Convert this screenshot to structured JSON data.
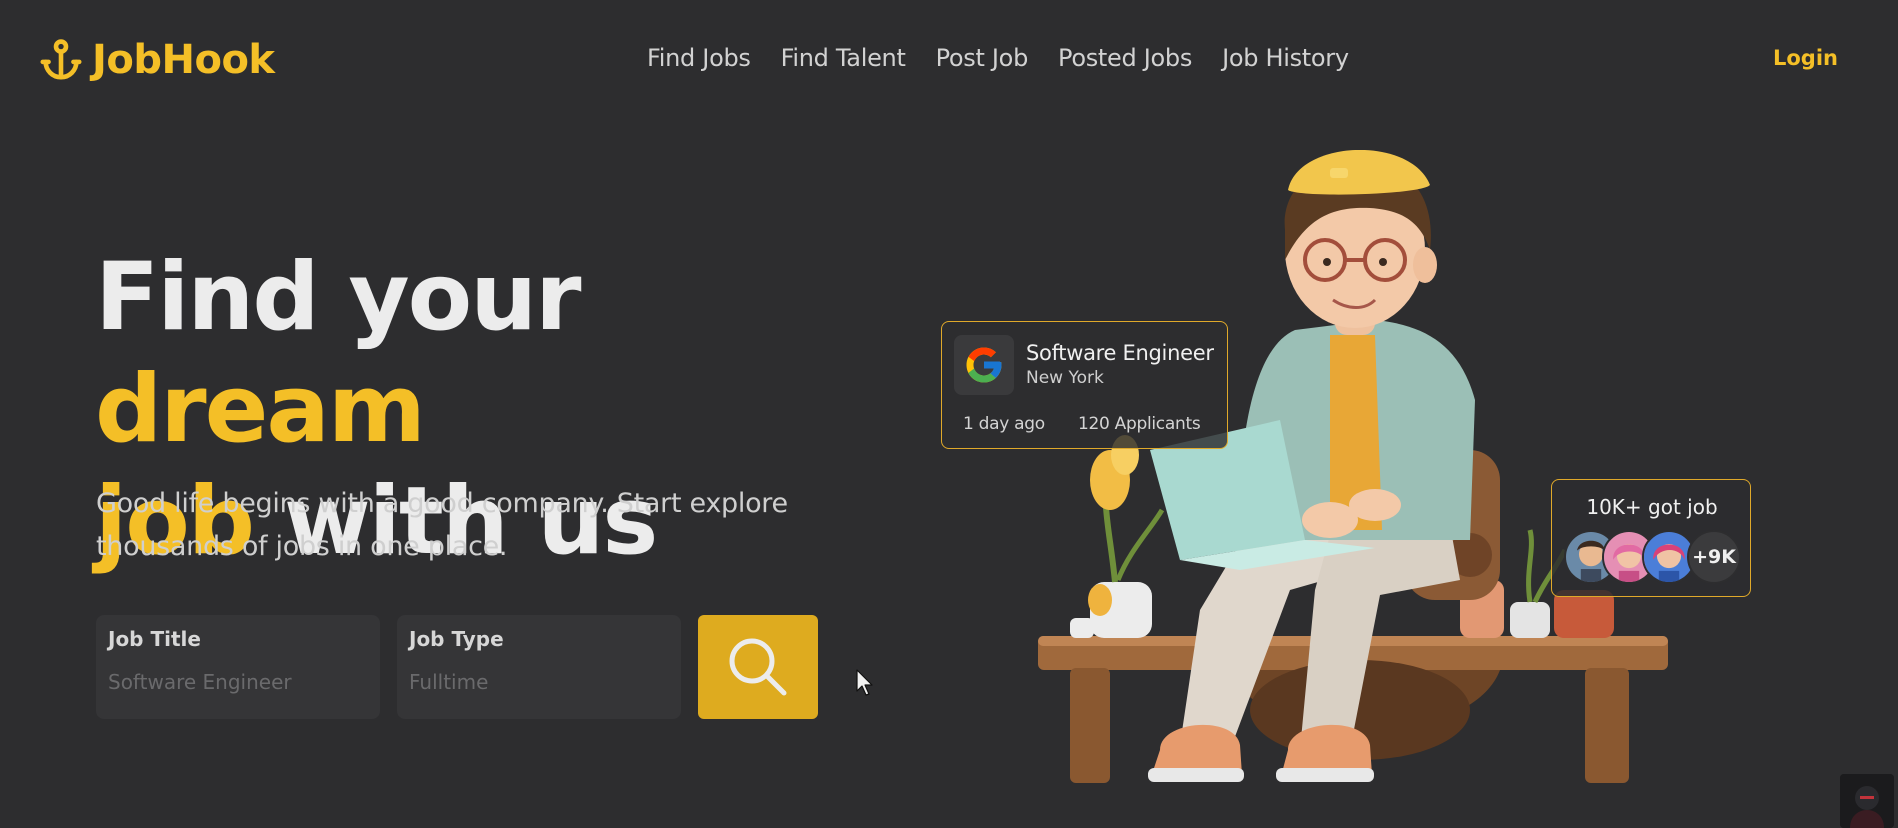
{
  "brand": {
    "name": "JobHook",
    "accent": "#f4bf27"
  },
  "nav": {
    "items": [
      {
        "label": "Find Jobs"
      },
      {
        "label": "Find Talent"
      },
      {
        "label": "Post Job"
      },
      {
        "label": "Posted Jobs"
      },
      {
        "label": "Job History"
      }
    ],
    "login_label": "Login"
  },
  "hero": {
    "title_part1": "Find your ",
    "title_accent1": "dream",
    "title_accent2": "job",
    "title_part2": " with us",
    "subtitle": "Good life begins with a good company. Start explore thousands of jobs in one place."
  },
  "search": {
    "job_title_label": "Job Title",
    "job_title_placeholder": "Software Engineer",
    "job_type_label": "Job Type",
    "job_type_placeholder": "Fulltime",
    "button_icon": "search-icon"
  },
  "job_card": {
    "company_icon": "google-logo",
    "title": "Software Engineer",
    "location": "New York",
    "posted": "1 day ago",
    "applicants": "120 Applicants"
  },
  "got_job_card": {
    "text": "10K+ got job",
    "extra_count": "+9K"
  }
}
